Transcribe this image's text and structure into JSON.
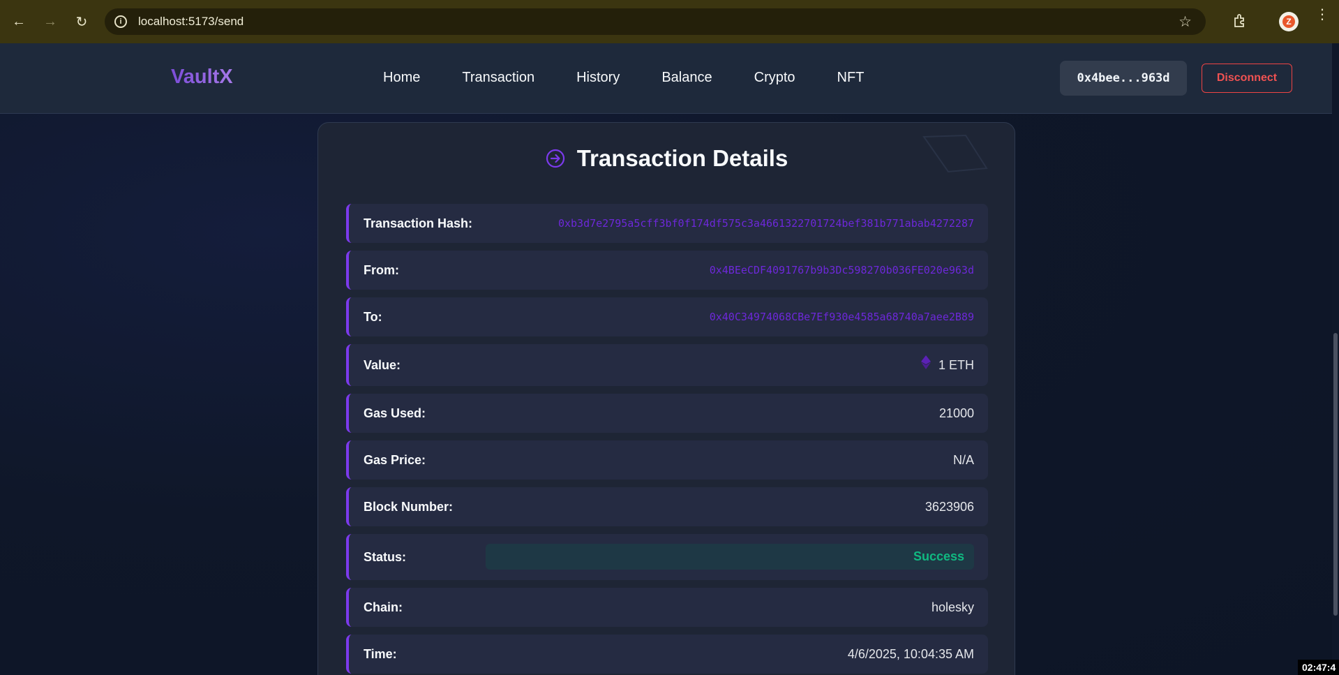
{
  "browser": {
    "url": "localhost:5173/send"
  },
  "header": {
    "logo": "VaultX",
    "nav": [
      "Home",
      "Transaction",
      "History",
      "Balance",
      "Crypto",
      "NFT"
    ],
    "wallet_address": "0x4bee...963d",
    "disconnect_label": "Disconnect"
  },
  "card": {
    "title": "Transaction Details",
    "rows": {
      "hash": {
        "label": "Transaction Hash:",
        "value": "0xb3d7e2795a5cff3bf0f174df575c3a4661322701724bef381b771abab4272287"
      },
      "from": {
        "label": "From:",
        "value": "0x4BEeCDF4091767b9b3Dc598270b036FE020e963d"
      },
      "to": {
        "label": "To:",
        "value": "0x40C34974068CBe7Ef930e4585a68740a7aee2B89"
      },
      "value": {
        "label": "Value:",
        "value": "1 ETH"
      },
      "gas_used": {
        "label": "Gas Used:",
        "value": "21000"
      },
      "gas_price": {
        "label": "Gas Price:",
        "value": "N/A"
      },
      "block": {
        "label": "Block Number:",
        "value": "3623906"
      },
      "status": {
        "label": "Status:",
        "value": "Success"
      },
      "chain": {
        "label": "Chain:",
        "value": "holesky"
      },
      "time": {
        "label": "Time:",
        "value": "4/6/2025, 10:04:35 AM"
      }
    }
  },
  "system_clock": "02:47:4",
  "colors": {
    "accent": "#7c3aed",
    "success": "#10b981",
    "danger": "#ef4444"
  }
}
